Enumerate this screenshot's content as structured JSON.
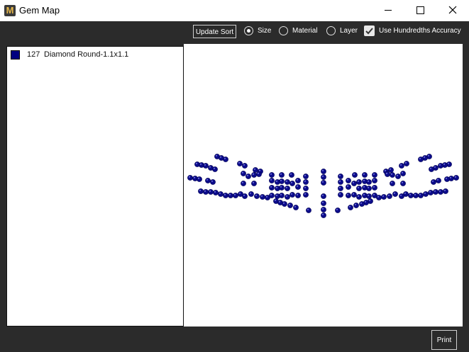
{
  "window": {
    "title": "Gem Map",
    "icon": "app-logo-icon",
    "logo_letter": "M"
  },
  "toolbar": {
    "update_sort_label": "Update Sort",
    "sort_options": [
      {
        "label": "Size",
        "selected": true
      },
      {
        "label": "Material",
        "selected": false
      },
      {
        "label": "Layer",
        "selected": false
      }
    ],
    "hundredths": {
      "label": "Use Hundredths Accuracy",
      "checked": true
    }
  },
  "gem_list": [
    {
      "count": "127",
      "name": "Diamond Round-1.1x1.1",
      "color": "#000080"
    }
  ],
  "gem_color": "#0b0b8a",
  "footer": {
    "print_label": "Print"
  }
}
